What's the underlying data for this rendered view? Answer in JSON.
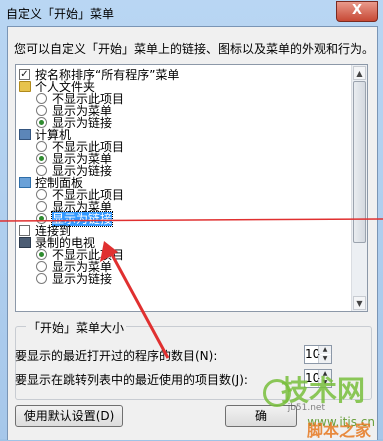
{
  "window": {
    "title": "自定义「开始」菜单",
    "close_glyph": "X"
  },
  "description": "您可以自定义「开始」菜单上的链接、图标以及菜单的外观和行为。",
  "list_items": [
    {
      "kind": "checkbox",
      "checked": true,
      "label": "按名称排序“所有程序”菜单"
    },
    {
      "kind": "group",
      "icon": "folder-icon",
      "label": "个人文件夹"
    },
    {
      "kind": "radio",
      "checked": false,
      "label": "不显示此项目"
    },
    {
      "kind": "radio",
      "checked": false,
      "label": "显示为菜单"
    },
    {
      "kind": "radio",
      "checked": true,
      "label": "显示为链接"
    },
    {
      "kind": "group",
      "icon": "computer-icon",
      "label": "计算机"
    },
    {
      "kind": "radio",
      "checked": false,
      "label": "不显示此项目"
    },
    {
      "kind": "radio",
      "checked": true,
      "label": "显示为菜单"
    },
    {
      "kind": "radio",
      "checked": false,
      "label": "显示为链接"
    },
    {
      "kind": "group",
      "icon": "control-panel-icon",
      "label": "控制面板"
    },
    {
      "kind": "radio",
      "checked": false,
      "label": "不显示此项目"
    },
    {
      "kind": "radio",
      "checked": false,
      "label": "显示为菜单"
    },
    {
      "kind": "radio",
      "checked": true,
      "label": "显示为链接",
      "selected": true
    },
    {
      "kind": "checkbox",
      "checked": false,
      "label": "连接到"
    },
    {
      "kind": "group",
      "icon": "tv-icon",
      "label": "录制的电视"
    },
    {
      "kind": "radio",
      "checked": true,
      "label": "不显示此项目"
    },
    {
      "kind": "radio",
      "checked": false,
      "label": "显示为菜单"
    },
    {
      "kind": "radio",
      "checked": false,
      "label": "显示为链接"
    }
  ],
  "size_group": {
    "title": "「开始」菜单大小",
    "recent_programs_label": "要显示的最近打开过的程序的数目(N):",
    "recent_programs_value": "10",
    "jump_list_label": "要显示在跳转列表中的最近使用的项目数(J):",
    "jump_list_value": "10"
  },
  "buttons": {
    "defaults": "使用默认设置(D)",
    "ok": "确"
  },
  "watermark": {
    "brand": "技术网",
    "url": "www.itjs.cn",
    "name": "脚本之家",
    "id": "jb51.net"
  },
  "colors": {
    "annotation_red": "#e03030",
    "selection": "#3399ff",
    "radio_dot": "#2e8b2e"
  }
}
